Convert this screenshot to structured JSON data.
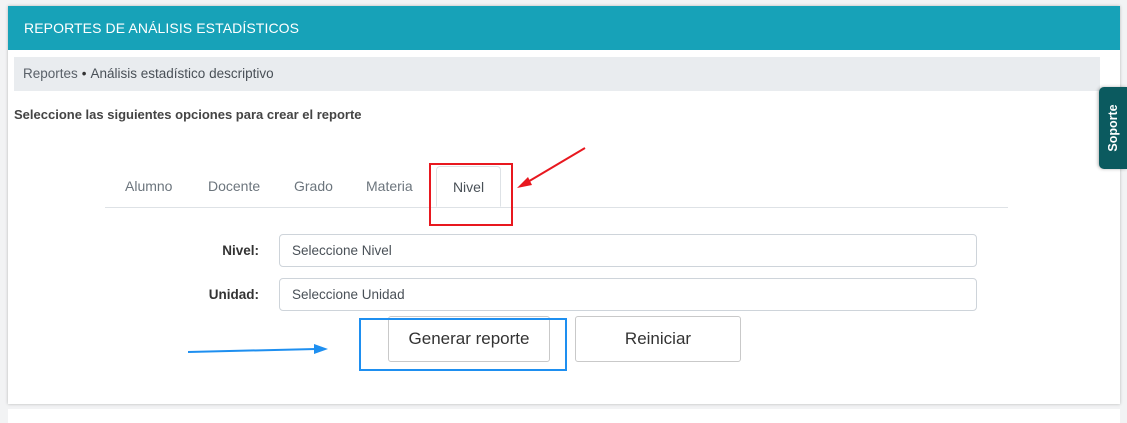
{
  "header": {
    "title": "REPORTES DE ANÁLISIS ESTADÍSTICOS"
  },
  "breadcrumb": {
    "parent": "Reportes",
    "separator": "•",
    "current": "Análisis estadístico descriptivo"
  },
  "instructions": "Seleccione las siguientes opciones para crear el reporte",
  "tabs": [
    {
      "label": "Alumno",
      "active": false
    },
    {
      "label": "Docente",
      "active": false
    },
    {
      "label": "Grado",
      "active": false
    },
    {
      "label": "Materia",
      "active": false
    },
    {
      "label": "Nivel",
      "active": true
    }
  ],
  "form": {
    "nivel": {
      "label": "Nivel:",
      "value": "Seleccione Nivel"
    },
    "unidad": {
      "label": "Unidad:",
      "value": "Seleccione Unidad"
    }
  },
  "buttons": {
    "generate": "Generar reporte",
    "reset": "Reiniciar"
  },
  "support": {
    "label": "Soporte"
  },
  "colors": {
    "header_bg": "#17a2b8",
    "support_bg": "#0b5a5f",
    "annotation_red": "#e8181f",
    "annotation_blue": "#1e8ff0"
  }
}
